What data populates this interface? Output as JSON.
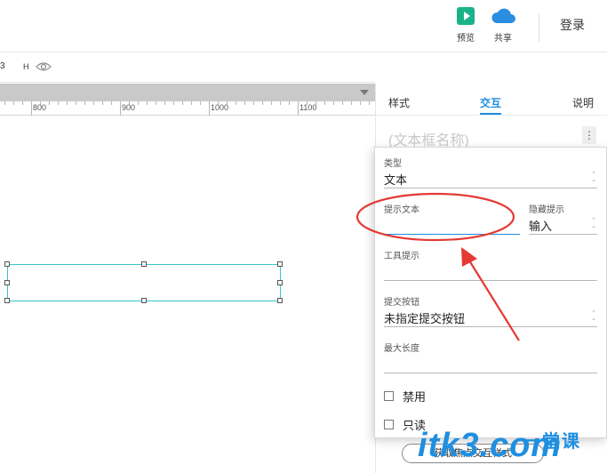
{
  "toolbar": {
    "preview_label": "预览",
    "share_label": "共享",
    "login_label": "登录"
  },
  "property_row": {
    "h_value": "3",
    "h_label": "H"
  },
  "ruler": {
    "labels": [
      "800",
      "900",
      "1000",
      "1100"
    ]
  },
  "right_panel": {
    "tabs": [
      "样式",
      "交互",
      "说明"
    ],
    "active_tab": "交互",
    "widget_name_placeholder": "(文本框名称)",
    "more_icon": "⋮"
  },
  "popup": {
    "type_label": "类型",
    "type_value": "文本",
    "hint_text_label": "提示文本",
    "hint_text_value": "",
    "hide_hint_label": "隐藏提示",
    "hide_hint_value": "输入",
    "tooltip_label": "工具提示",
    "tooltip_value": "",
    "submit_button_label": "提交按钮",
    "submit_button_value": "未指定提交按钮",
    "max_length_label": "最大长度",
    "max_length_value": "",
    "disabled_label": "禁用",
    "disabled_checked": false,
    "readonly_label": "只读",
    "readonly_checked": false
  },
  "focus_style_button_label": "获取焦点交互样式",
  "watermark": {
    "text": "itk3.com",
    "sub": "一堂课"
  },
  "colors": {
    "accent": "#1d8ddc",
    "preview_green": "#19b389",
    "share_blue": "#2a8de0",
    "selection_teal": "#39c6c6",
    "annotation_red": "#e53935",
    "watermark_blue": "#1e8fe1"
  }
}
